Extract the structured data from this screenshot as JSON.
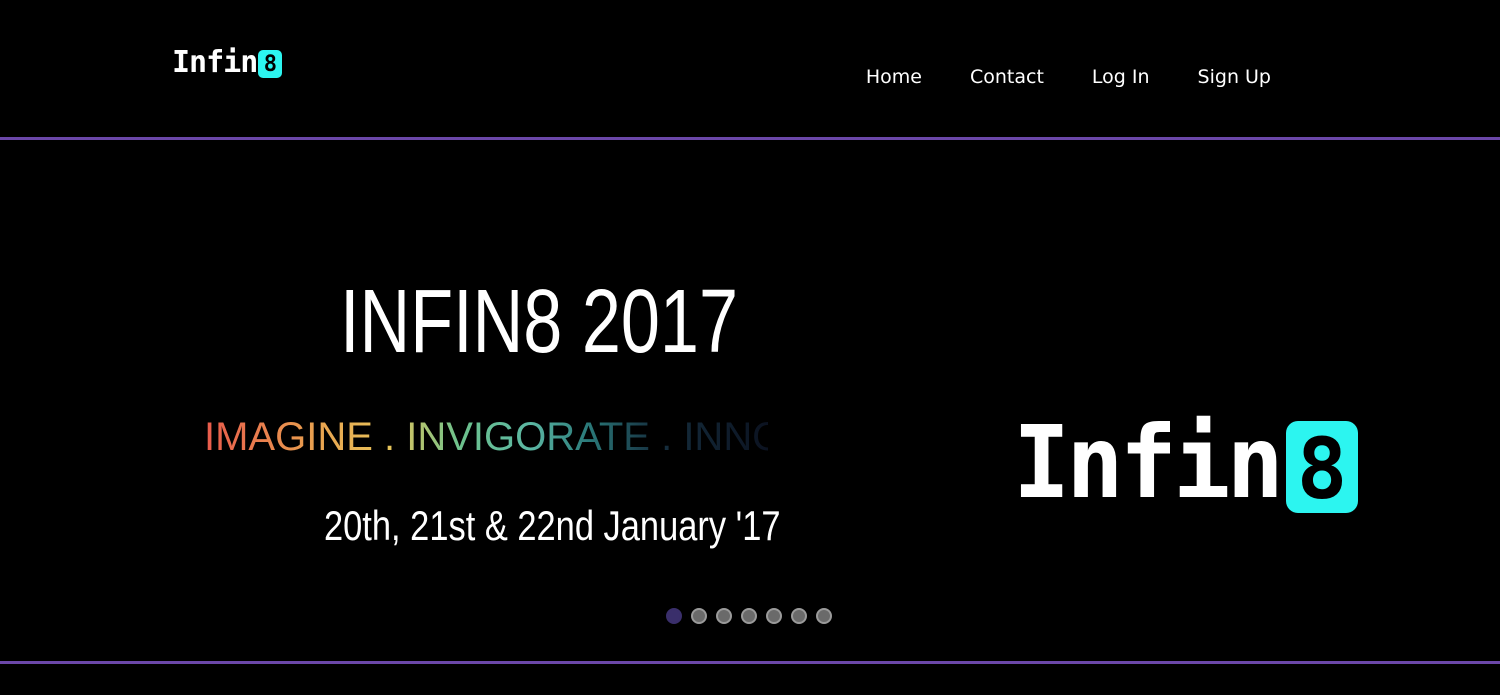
{
  "header": {
    "logo": {
      "text": "Infin",
      "eight": "8"
    },
    "nav": [
      {
        "label": "Home"
      },
      {
        "label": "Contact"
      },
      {
        "label": "Log In"
      },
      {
        "label": "Sign Up"
      }
    ]
  },
  "hero": {
    "title": "INFIN8 2017",
    "tagline": "IMAGINE . INVIGORATE . INNOVATE",
    "dates": "20th, 21st & 22nd January '17",
    "logo": {
      "text": "Infin",
      "eight": "8"
    }
  },
  "carousel": {
    "total_slides": 7,
    "active_index": 0
  },
  "colors": {
    "background": "#000000",
    "accent_rule": "#6b47a8",
    "logo_eight": "#2cf5f0",
    "dot_active": "#3a2f6b",
    "dot_inactive": "#6a6a6a"
  }
}
